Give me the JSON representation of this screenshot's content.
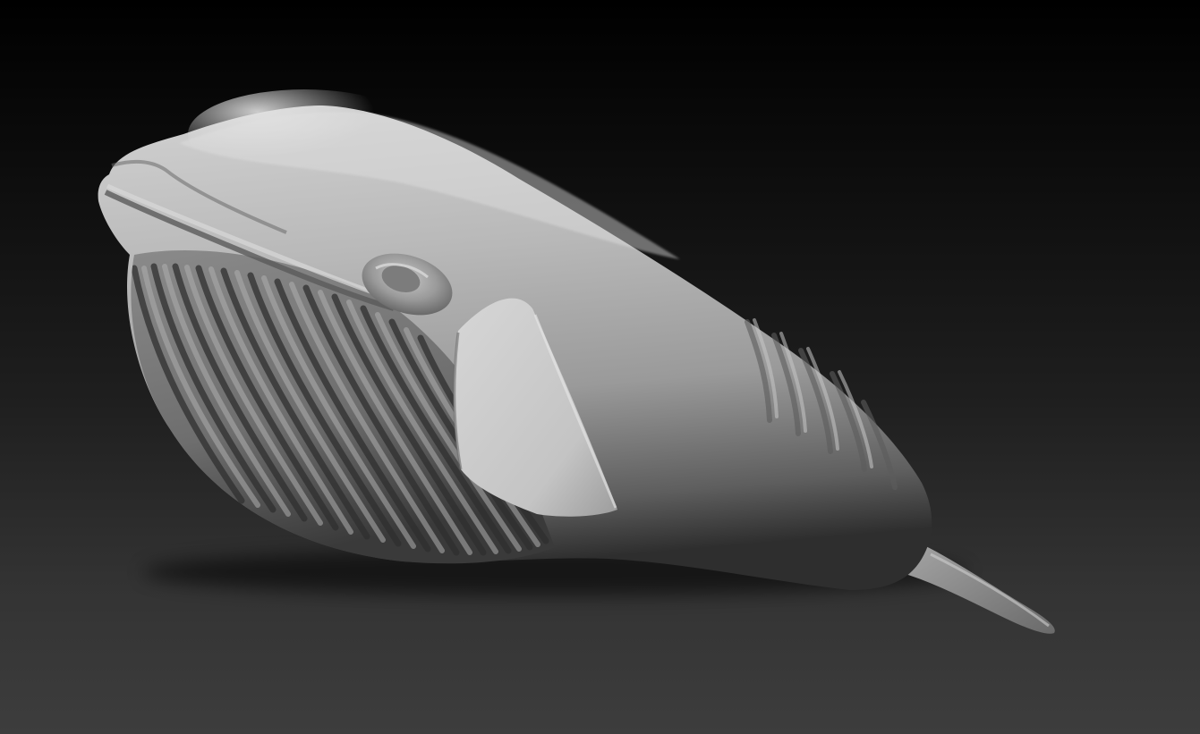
{
  "scene": {
    "subject": "whale-sculpt",
    "colors": {
      "background_top": "#000000",
      "background_bottom": "#3d3d3d",
      "clay_highlight": "#dcdcdc",
      "clay_mid": "#a9a9a9",
      "clay_shadow": "#4a4a4a"
    }
  }
}
